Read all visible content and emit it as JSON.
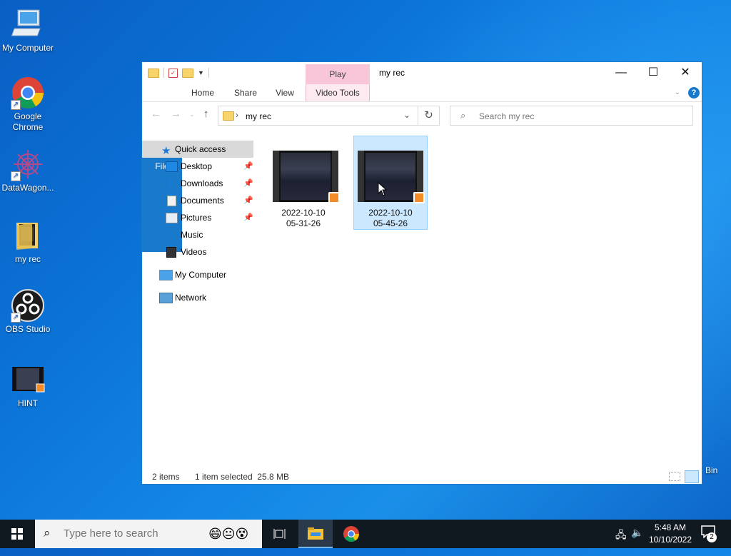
{
  "desktop": {
    "icons": [
      {
        "label": "My Computer",
        "icon": "computer-icon"
      },
      {
        "label": "Google\nChrome",
        "icon": "chrome-icon"
      },
      {
        "label": "DataWagon...",
        "icon": "datawagon-icon"
      },
      {
        "label": "my rec",
        "icon": "folder-icon"
      },
      {
        "label": "OBS Studio",
        "icon": "obs-icon"
      },
      {
        "label": "HINT",
        "icon": "video-file-icon"
      }
    ],
    "recycle_bin_partial_label": "Bin"
  },
  "window": {
    "title": "my rec",
    "context_tab": "Play",
    "ribbon_tabs": [
      "File",
      "Home",
      "Share",
      "View",
      "Video Tools"
    ],
    "address": {
      "path": "my rec"
    },
    "search": {
      "placeholder": "Search my rec"
    },
    "nav_pane": {
      "quick_access": "Quick access",
      "items": [
        {
          "label": "Desktop",
          "pinned": true
        },
        {
          "label": "Downloads",
          "pinned": true
        },
        {
          "label": "Documents",
          "pinned": true
        },
        {
          "label": "Pictures",
          "pinned": true
        },
        {
          "label": "Music",
          "pinned": false
        },
        {
          "label": "Videos",
          "pinned": false
        }
      ],
      "my_computer": "My Computer",
      "network": "Network"
    },
    "files": [
      {
        "name_line1": "2022-10-10",
        "name_line2": "05-31-26",
        "selected": false
      },
      {
        "name_line1": "2022-10-10",
        "name_line2": "05-45-26",
        "selected": true
      }
    ],
    "status": {
      "count": "2 items",
      "selection": "1 item selected  25.8 MB"
    }
  },
  "taskbar": {
    "search_placeholder": "Type here to search",
    "clock_time": "5:48 AM",
    "clock_date": "10/10/2022",
    "notification_count": "2"
  },
  "colors": {
    "accent": "#1979ca",
    "selection": "#cce8ff",
    "taskbar": "#101820",
    "play_tab": "#f8c6d8"
  }
}
